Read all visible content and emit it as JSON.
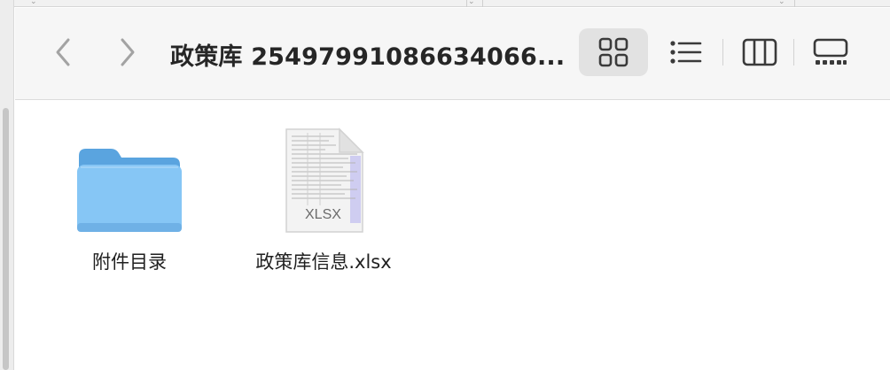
{
  "window": {
    "title": "政策库 25497991086634066..."
  },
  "toolbar": {
    "back_icon": "chevron-left-icon",
    "forward_icon": "chevron-right-icon",
    "views": [
      {
        "name": "icon-view",
        "icon": "grid-icon",
        "selected": true
      },
      {
        "name": "list-view",
        "icon": "list-icon",
        "selected": false
      },
      {
        "name": "column-view",
        "icon": "columns-icon",
        "selected": false
      },
      {
        "name": "gallery-view",
        "icon": "gallery-icon",
        "selected": false
      }
    ]
  },
  "files": [
    {
      "name": "附件目录",
      "kind": "folder",
      "icon": "folder-icon",
      "color": "#6fb8f0"
    },
    {
      "name": "政策库信息.xlsx",
      "kind": "xlsx",
      "icon": "spreadsheet-file-icon",
      "badge": "XLSX"
    }
  ]
}
